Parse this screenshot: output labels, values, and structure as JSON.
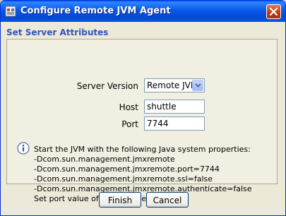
{
  "window": {
    "title": "Configure Remote JVM Agent"
  },
  "section": {
    "title": "Set Server Attributes"
  },
  "form": {
    "server_version_label": "Server Version",
    "server_version_value": "Remote JVM",
    "host_label": "Host",
    "host_value": "shuttle",
    "port_label": "Port",
    "port_value": "7744"
  },
  "info": {
    "lines": [
      "Start the JVM with the following Java system properties:",
      "-Dcom.sun.management.jmxremote",
      "-Dcom.sun.management.jmxremote.port=7744",
      "-Dcom.sun.management.jmxremote.ssl=false",
      "-Dcom.sun.management.jmxremote.authenticate=false",
      "Set port value of your choice."
    ]
  },
  "buttons": {
    "finish": "Finish",
    "cancel": "Cancel"
  },
  "colors": {
    "titlebar": "#0a58e8",
    "section_title": "#2c55c4",
    "close_button": "#c2360f"
  },
  "icons": {
    "title": "app-icon",
    "close": "close-icon",
    "dropdown": "chevron-down-icon",
    "info": "info-icon"
  }
}
